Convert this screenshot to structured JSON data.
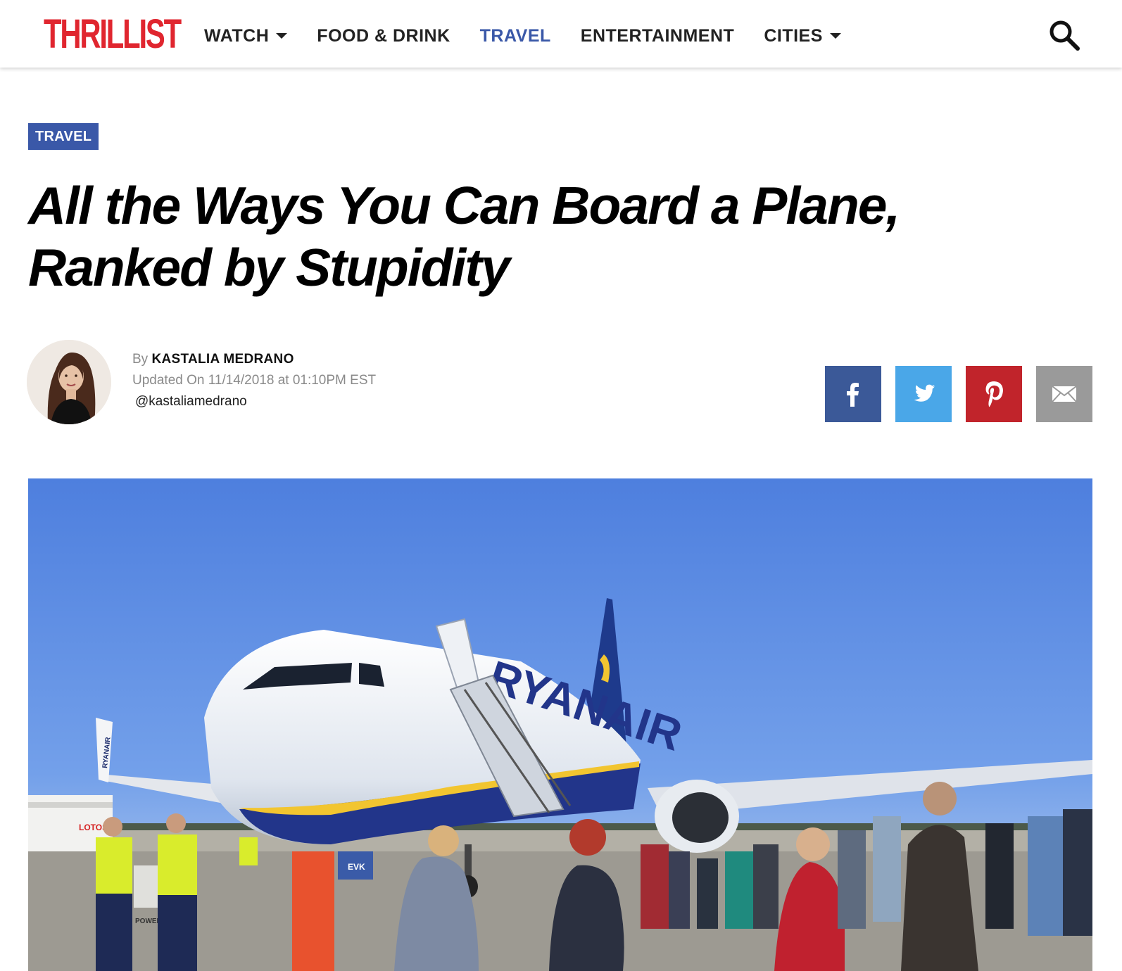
{
  "header": {
    "logo_text": "THRILLIST",
    "logo_color": "#e0262f",
    "nav": [
      {
        "label": "WATCH",
        "has_dropdown": true,
        "active": false
      },
      {
        "label": "FOOD & DRINK",
        "has_dropdown": false,
        "active": false
      },
      {
        "label": "TRAVEL",
        "has_dropdown": false,
        "active": true
      },
      {
        "label": "ENTERTAINMENT",
        "has_dropdown": false,
        "active": false
      },
      {
        "label": "CITIES",
        "has_dropdown": true,
        "active": false
      }
    ],
    "search_icon": "search-icon",
    "active_color": "#3a58a8"
  },
  "article": {
    "category": "TRAVEL",
    "headline": "All the Ways You Can Board a Plane, Ranked by Stupidity",
    "byline": {
      "prefix": "By",
      "author": "KASTALIA MEDRANO",
      "updated": "Updated On 11/14/2018 at 01:10PM EST",
      "handle": "@kastaliamedrano"
    },
    "share": [
      {
        "network": "facebook",
        "icon": "facebook-icon",
        "color": "#3b5998"
      },
      {
        "network": "twitter",
        "icon": "twitter-icon",
        "color": "#4aa7e8"
      },
      {
        "network": "pinterest",
        "icon": "pinterest-icon",
        "color": "#c1242b"
      },
      {
        "network": "email",
        "icon": "email-icon",
        "color": "#9a9a9a"
      }
    ],
    "hero_image": {
      "texts": {
        "airline": "RYANAIR",
        "truck": "LOTOS",
        "gpu": "POWER",
        "vest": "EVK"
      }
    }
  }
}
